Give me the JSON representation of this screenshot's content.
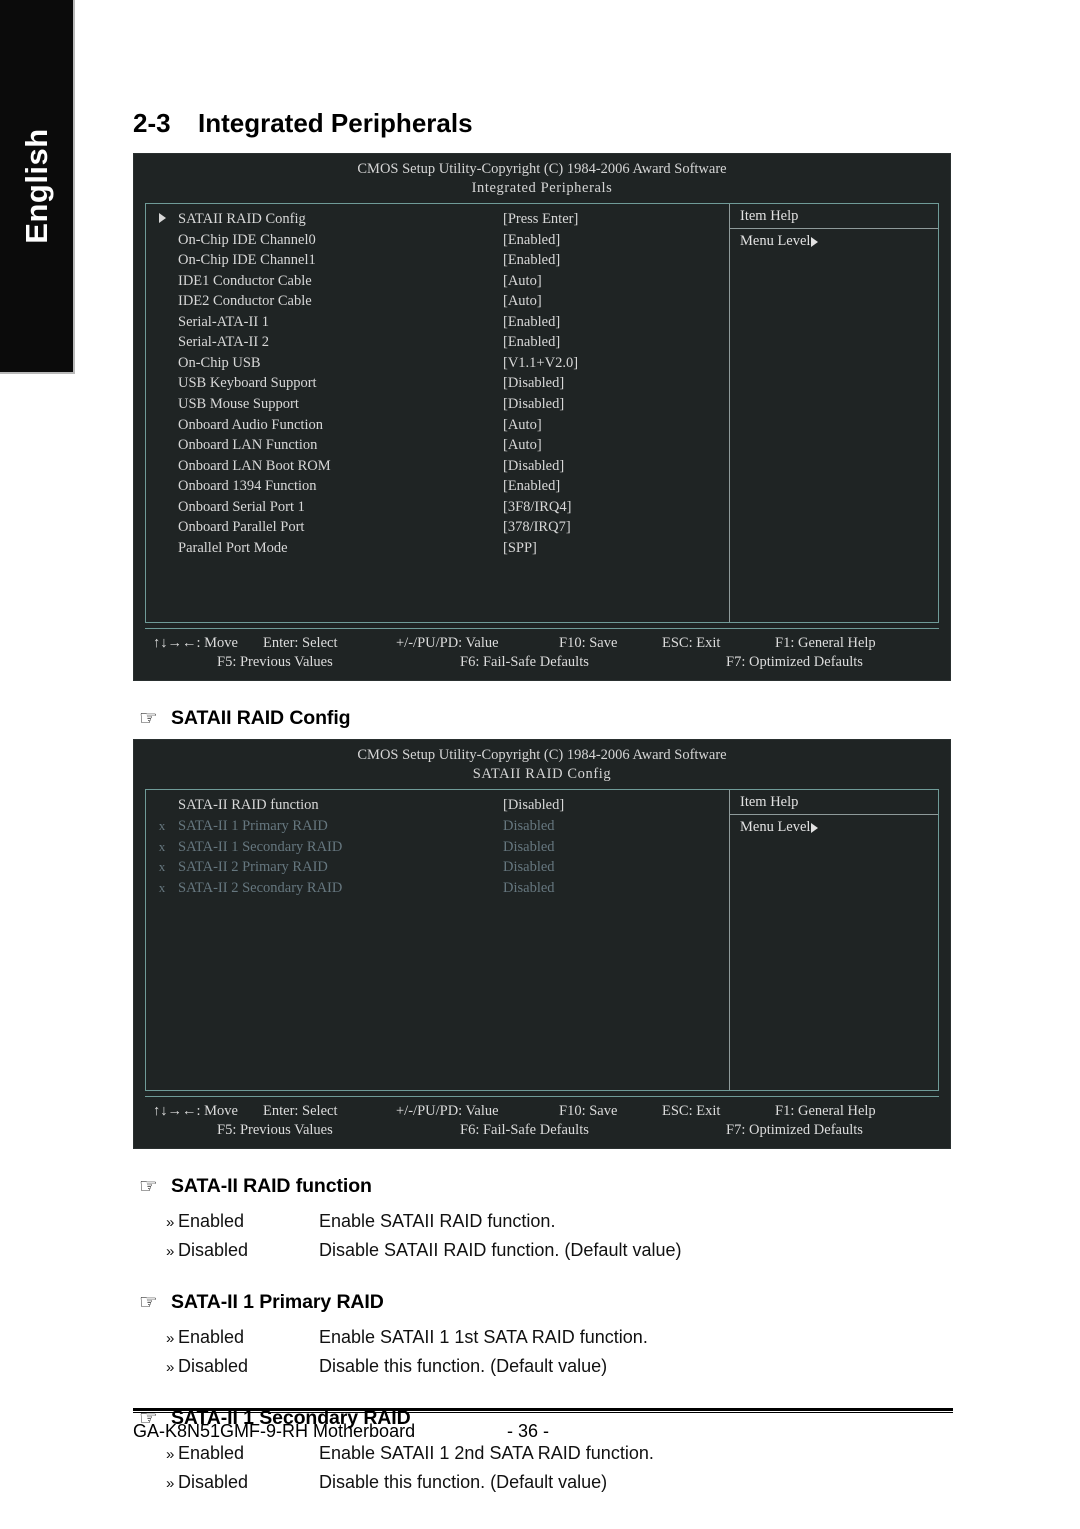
{
  "language_tab": {
    "label": "English"
  },
  "section": {
    "number": "2-3",
    "title": "Integrated Peripherals"
  },
  "bios_screen_1": {
    "copyright": "CMOS Setup Utility-Copyright (C) 1984-2006 Award Software",
    "screen_title": "Integrated Peripherals",
    "rows": [
      {
        "mark": "arrow",
        "label": "SATAII RAID Config",
        "value": "[Press Enter]",
        "dim": false
      },
      {
        "mark": "",
        "label": "On-Chip IDE Channel0",
        "value": "[Enabled]",
        "dim": false
      },
      {
        "mark": "",
        "label": "On-Chip IDE Channel1",
        "value": "[Enabled]",
        "dim": false
      },
      {
        "mark": "",
        "label": "IDE1 Conductor Cable",
        "value": "[Auto]",
        "dim": false
      },
      {
        "mark": "",
        "label": "IDE2 Conductor Cable",
        "value": "[Auto]",
        "dim": false
      },
      {
        "mark": "",
        "label": "Serial-ATA-II 1",
        "value": "[Enabled]",
        "dim": false
      },
      {
        "mark": "",
        "label": "Serial-ATA-II 2",
        "value": "[Enabled]",
        "dim": false
      },
      {
        "mark": "",
        "label": "On-Chip USB",
        "value": "[V1.1+V2.0]",
        "dim": false
      },
      {
        "mark": "",
        "label": "USB Keyboard Support",
        "value": "[Disabled]",
        "dim": false
      },
      {
        "mark": "",
        "label": "USB Mouse Support",
        "value": "[Disabled]",
        "dim": false
      },
      {
        "mark": "",
        "label": "Onboard Audio Function",
        "value": "[Auto]",
        "dim": false
      },
      {
        "mark": "",
        "label": "Onboard LAN Function",
        "value": "[Auto]",
        "dim": false
      },
      {
        "mark": "",
        "label": "Onboard LAN Boot ROM",
        "value": "[Disabled]",
        "dim": false
      },
      {
        "mark": "",
        "label": "Onboard 1394 Function",
        "value": "[Enabled]",
        "dim": false
      },
      {
        "mark": "",
        "label": "Onboard Serial Port 1",
        "value": "[3F8/IRQ4]",
        "dim": false
      },
      {
        "mark": "",
        "label": "Onboard Parallel Port",
        "value": "[378/IRQ7]",
        "dim": false
      },
      {
        "mark": "",
        "label": "Parallel Port Mode",
        "value": "[SPP]",
        "dim": false
      }
    ],
    "item_help_title": "Item Help",
    "menu_level_label": "Menu Level",
    "footer": {
      "move": "↑↓→←: Move",
      "select": "Enter: Select",
      "value": "+/-/PU/PD: Value",
      "save": "F10: Save",
      "exit": "ESC: Exit",
      "general_help": "F1: General Help",
      "previous_values": "F5: Previous Values",
      "fail_safe": "F6: Fail-Safe Defaults",
      "optimized": "F7: Optimized Defaults"
    }
  },
  "sataii_raid_config_heading": "SATAII RAID Config",
  "bios_screen_2": {
    "copyright": "CMOS Setup Utility-Copyright (C) 1984-2006 Award Software",
    "screen_title": "SATAII RAID Config",
    "rows": [
      {
        "mark": "",
        "label": "SATA-II RAID function",
        "value": "[Disabled]",
        "dim": false
      },
      {
        "mark": "x",
        "label": "SATA-II 1 Primary RAID",
        "value": "Disabled",
        "dim": true
      },
      {
        "mark": "x",
        "label": "SATA-II 1 Secondary RAID",
        "value": "Disabled",
        "dim": true
      },
      {
        "mark": "x",
        "label": "SATA-II 2 Primary RAID",
        "value": "Disabled",
        "dim": true
      },
      {
        "mark": "x",
        "label": "SATA-II 2 Secondary RAID",
        "value": "Disabled",
        "dim": true
      }
    ],
    "item_help_title": "Item Help",
    "menu_level_label": "Menu Level",
    "footer": {
      "move": "↑↓→←: Move",
      "select": "Enter: Select",
      "value": "+/-/PU/PD: Value",
      "save": "F10: Save",
      "exit": "ESC: Exit",
      "general_help": "F1: General Help",
      "previous_values": "F5: Previous Values",
      "fail_safe": "F6: Fail-Safe Defaults",
      "optimized": "F7: Optimized Defaults"
    }
  },
  "option_sections": [
    {
      "heading": "SATA-II RAID function",
      "options": [
        {
          "name": "Enabled",
          "desc": "Enable SATAII RAID function."
        },
        {
          "name": "Disabled",
          "desc": "Disable SATAII RAID function. (Default value)"
        }
      ]
    },
    {
      "heading": "SATA-II 1 Primary RAID",
      "options": [
        {
          "name": "Enabled",
          "desc": "Enable SATAII 1 1st SATA RAID function."
        },
        {
          "name": "Disabled",
          "desc": "Disable this function. (Default value)"
        }
      ]
    },
    {
      "heading": "SATA-II 1 Secondary RAID",
      "options": [
        {
          "name": "Enabled",
          "desc": "Enable SATAII 1 2nd SATA RAID function."
        },
        {
          "name": "Disabled",
          "desc": "Disable this function. (Default value)"
        }
      ]
    }
  ],
  "page_footer": {
    "board": "GA-K8N51GMF-9-RH Motherboard",
    "page": "- 36 -"
  },
  "icons": {
    "hand": "☞",
    "double_arrow": "»"
  }
}
